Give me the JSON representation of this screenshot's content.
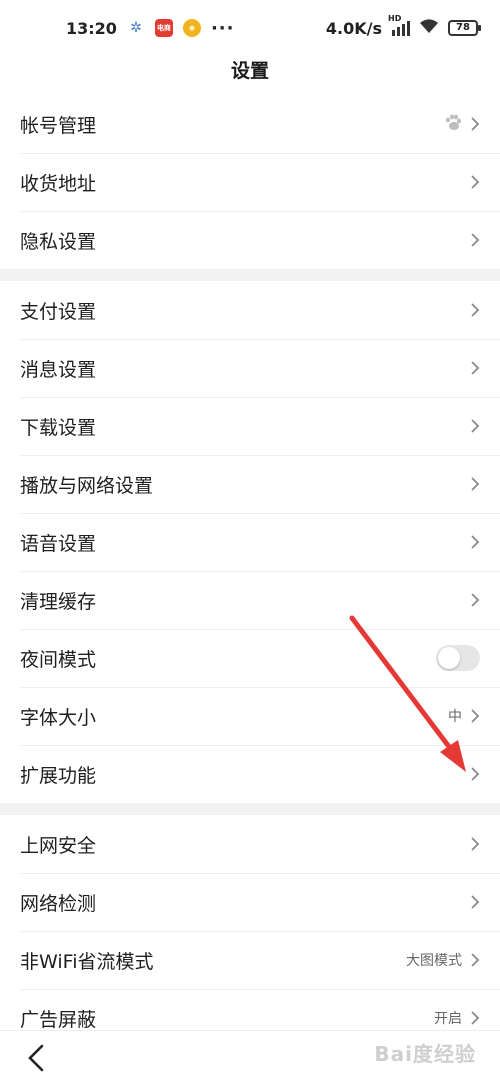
{
  "status_bar": {
    "time": "13:20",
    "app_icon_red_text": "电商",
    "dots": "···",
    "speed": "4.0K/s",
    "network_type": "HD",
    "battery": "78"
  },
  "header": {
    "title": "设置"
  },
  "groups": [
    {
      "items": [
        {
          "label": "帐号管理",
          "value": "",
          "icon": "baidu-paw-icon"
        },
        {
          "label": "收货地址",
          "value": ""
        },
        {
          "label": "隐私设置",
          "value": ""
        }
      ]
    },
    {
      "items": [
        {
          "label": "支付设置",
          "value": ""
        },
        {
          "label": "消息设置",
          "value": ""
        },
        {
          "label": "下载设置",
          "value": ""
        },
        {
          "label": "播放与网络设置",
          "value": ""
        },
        {
          "label": "语音设置",
          "value": ""
        },
        {
          "label": "清理缓存",
          "value": ""
        },
        {
          "label": "夜间模式",
          "toggle": false
        },
        {
          "label": "字体大小",
          "value": "中"
        },
        {
          "label": "扩展功能",
          "value": ""
        }
      ]
    },
    {
      "items": [
        {
          "label": "上网安全",
          "value": ""
        },
        {
          "label": "网络检测",
          "value": ""
        },
        {
          "label": "非WiFi省流模式",
          "value": "大图模式"
        },
        {
          "label": "广告屏蔽",
          "value": "开启"
        }
      ]
    }
  ],
  "watermark": "Bai度经验",
  "colors": {
    "annotation_arrow": "#e53935",
    "divider": "#f2f2f2"
  }
}
